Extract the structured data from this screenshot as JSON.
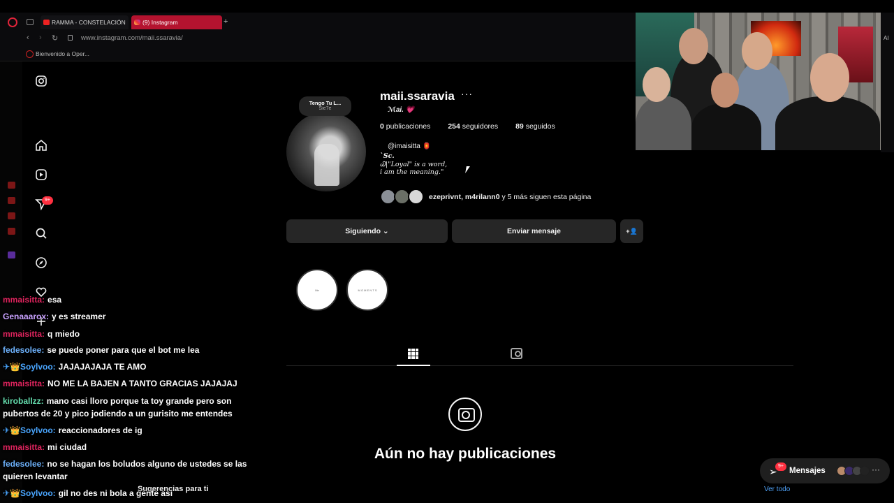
{
  "browser": {
    "tabs": [
      {
        "label": "RAMMA - CONSTELACIÓN"
      },
      {
        "label": "(9) Instagram"
      }
    ],
    "new_tab": "+",
    "url": "www.instagram.com/maii.ssaravia/",
    "bookmark": "Bienvenido a Oper...",
    "right_edge_text": "AI"
  },
  "ig_nav": {
    "notifications_badge": "9+"
  },
  "profile": {
    "note_title": "Tengo Tu L...",
    "note_artist": "Sie7e",
    "username": "maii.ssaravia",
    "more": "···",
    "full_name": "ℳai.",
    "full_name_heart": "💗",
    "stats": {
      "posts_count": "0",
      "posts_label": "publicaciones",
      "followers_count": "254",
      "followers_label": "seguidores",
      "following_count": "89",
      "following_label": "seguidos"
    },
    "mention": "@imaisitta 🏮",
    "bio_lines": [
      "`Sc.",
      "Ꮚ|\"Loyal\" is a word,",
      "i am the meaning.\""
    ],
    "mutuals_names": "ezeprivnt, m4rilann0",
    "mutuals_rest": "y 5 más siguen esta página",
    "btn_following": "Siguiendo ⌄",
    "btn_message": "Enviar mensaje",
    "btn_suggest_icon": "+👤",
    "highlights": [
      "Me",
      "M O M E N T S"
    ],
    "no_posts": "Aún no hay publicaciones",
    "suggestions": "Sugerencias para ti"
  },
  "chat": [
    {
      "user": "mmaisitta:",
      "text": "esa",
      "color": "#e0245e"
    },
    {
      "user": "Genaaarox:",
      "text": "y es streamer",
      "color": "#c9a2ff"
    },
    {
      "user": "mmaisitta:",
      "text": "q miedo",
      "color": "#e0245e"
    },
    {
      "user": "fedesolee:",
      "text": "se puede poner para que el bot me lea",
      "color": "#6fb4ff"
    },
    {
      "user": "✈👑Soylvoo:",
      "text": "JAJAJAJAJA TE AMO",
      "color": "#4aa6ff"
    },
    {
      "user": "mmaisitta:",
      "text": "NO ME LA BAJEN A TANTO GRACIAS JAJAJAJ",
      "color": "#e0245e"
    },
    {
      "user": "kiroballzz:",
      "text": "mano casi lloro porque ta toy grande pero son pubertos de 20 y pico jodiendo a un gurisito me entendes",
      "color": "#66e0b0"
    },
    {
      "user": "✈👑Soylvoo:",
      "text": "reaccionadores de ig",
      "color": "#4aa6ff"
    },
    {
      "user": "mmaisitta:",
      "text": "mi ciudad",
      "color": "#e0245e"
    },
    {
      "user": "fedesolee:",
      "text": "no se hagan los boludos alguno de ustedes se las quieren levantar",
      "color": "#6fb4ff"
    },
    {
      "user": "✈👑Soylvoo:",
      "text": "gil no des ni bola a gente asi",
      "color": "#4aa6ff"
    }
  ],
  "messages_box": {
    "label": "Mensajes",
    "badge": "9+",
    "more": "···"
  },
  "see_all": "Ver todo"
}
